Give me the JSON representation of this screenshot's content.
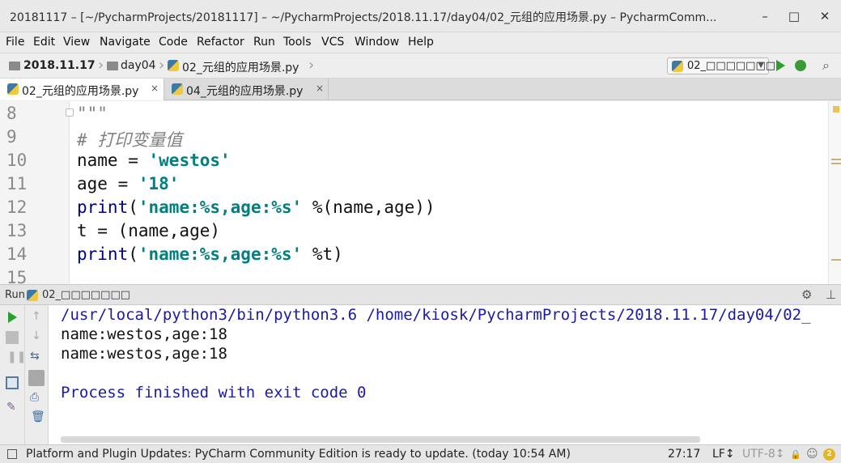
{
  "window": {
    "title": "20181117 – [~/PycharmProjects/20181117] – ~/PycharmProjects/2018.11.17/day04/02_元组的应用场景.py – PycharmComm...",
    "minimize": "–",
    "maximize": "□",
    "close": "✕"
  },
  "menu": [
    "File",
    "Edit",
    "View",
    "Navigate",
    "Code",
    "Refactor",
    "Run",
    "Tools",
    "VCS",
    "Window",
    "Help"
  ],
  "breadcrumb": {
    "project": "2018.11.17",
    "folder": "day04",
    "file": "02_元组的应用场景.py"
  },
  "run_config": {
    "label": "02_□□□□□□□"
  },
  "tabs": [
    {
      "label": "02_元组的应用场景.py",
      "active": true
    },
    {
      "label": "04_元组的应用场景.py",
      "active": false
    }
  ],
  "tab_close": "×",
  "editor": {
    "lines": [
      {
        "n": "8",
        "html_parts": [
          {
            "t": "\"\"\"",
            "c": "c-comment"
          }
        ]
      },
      {
        "n": "9",
        "html_parts": [
          {
            "t": "# 打印变量值",
            "c": "c-comment"
          }
        ]
      },
      {
        "n": "10",
        "html_parts": [
          {
            "t": "name = ",
            "c": ""
          },
          {
            "t": "'westos'",
            "c": "c-str"
          }
        ]
      },
      {
        "n": "11",
        "html_parts": [
          {
            "t": "age = ",
            "c": ""
          },
          {
            "t": "'18'",
            "c": "c-str"
          }
        ]
      },
      {
        "n": "12",
        "html_parts": [
          {
            "t": "print",
            "c": "c-kw"
          },
          {
            "t": "(",
            "c": ""
          },
          {
            "t": "'name:%s,age:%s'",
            "c": "c-str"
          },
          {
            "t": " %(name,age))",
            "c": ""
          }
        ]
      },
      {
        "n": "13",
        "html_parts": [
          {
            "t": "t = (name,age)",
            "c": ""
          }
        ]
      },
      {
        "n": "14",
        "html_parts": [
          {
            "t": "print",
            "c": "c-kw"
          },
          {
            "t": "(",
            "c": ""
          },
          {
            "t": "'name:%s,age:%s'",
            "c": "c-str"
          },
          {
            "t": " %t)",
            "c": ""
          }
        ]
      },
      {
        "n": "15",
        "html_parts": []
      }
    ]
  },
  "run_panel": {
    "title": "Run",
    "config": "02_□□□□□□□",
    "gear": "⚙",
    "hide": "⊥"
  },
  "console": {
    "lines": [
      {
        "text": "/usr/local/python3/bin/python3.6 /home/kiosk/PycharmProjects/2018.11.17/day04/02_",
        "kind": "cmd"
      },
      {
        "text": "name:westos,age:18",
        "kind": "out"
      },
      {
        "text": "name:westos,age:18",
        "kind": "out"
      },
      {
        "text": "",
        "kind": "out"
      },
      {
        "text": "Process finished with exit code 0",
        "kind": "done"
      }
    ]
  },
  "status": {
    "message": "Platform and Plugin Updates: PyCharm Community Edition is ready to update. (today 10:54 AM)",
    "position": "27:17",
    "line_sep": "LF↕",
    "encoding": "UTF-8↕",
    "lock": "🔒",
    "badge": "2"
  }
}
